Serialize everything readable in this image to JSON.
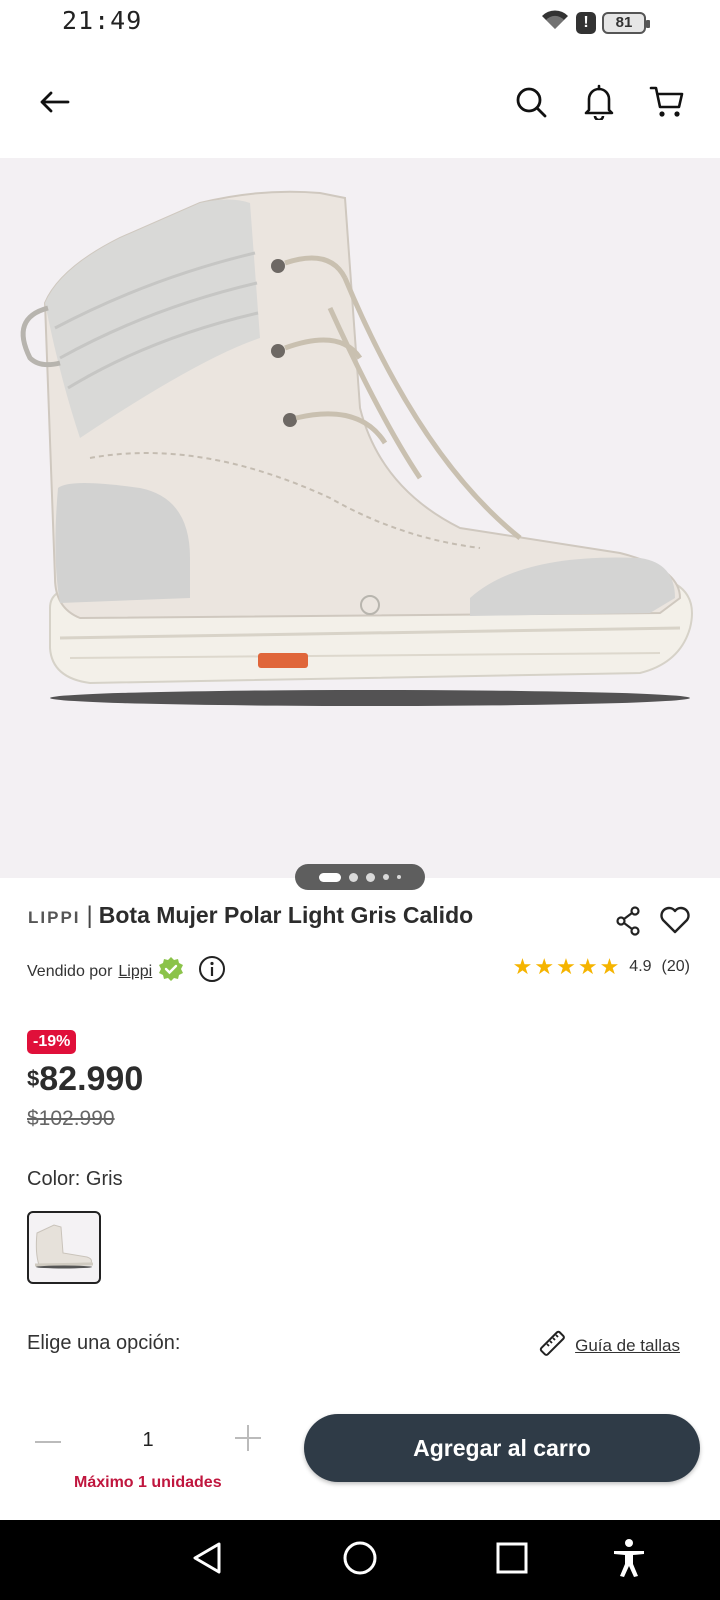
{
  "status": {
    "time": "21:49",
    "battery": "81"
  },
  "product": {
    "brand": "LIPPI",
    "separator": "|",
    "title": "Bota Mujer Polar Light Gris Calido",
    "seller_prefix": "Vendido por",
    "seller_name": "Lippi",
    "rating": "4.9",
    "rating_count": "(20)",
    "stars": 5
  },
  "pricing": {
    "discount": "-19%",
    "currency": "$",
    "price": "82.990",
    "old_price": "$102.990"
  },
  "options": {
    "color_label": "Color: Gris",
    "choose_label": "Elige una opción:",
    "size_guide": "Guía de tallas"
  },
  "cart": {
    "quantity": "1",
    "max_note": "Máximo 1 unidades",
    "add_button": "Agregar al carro"
  },
  "gallery": {
    "total_images": 5,
    "current_index": 1
  },
  "colors": {
    "accent": "#2f3b47",
    "discount": "#e0103a",
    "star": "#f5b400",
    "verified": "#8bc34a"
  }
}
